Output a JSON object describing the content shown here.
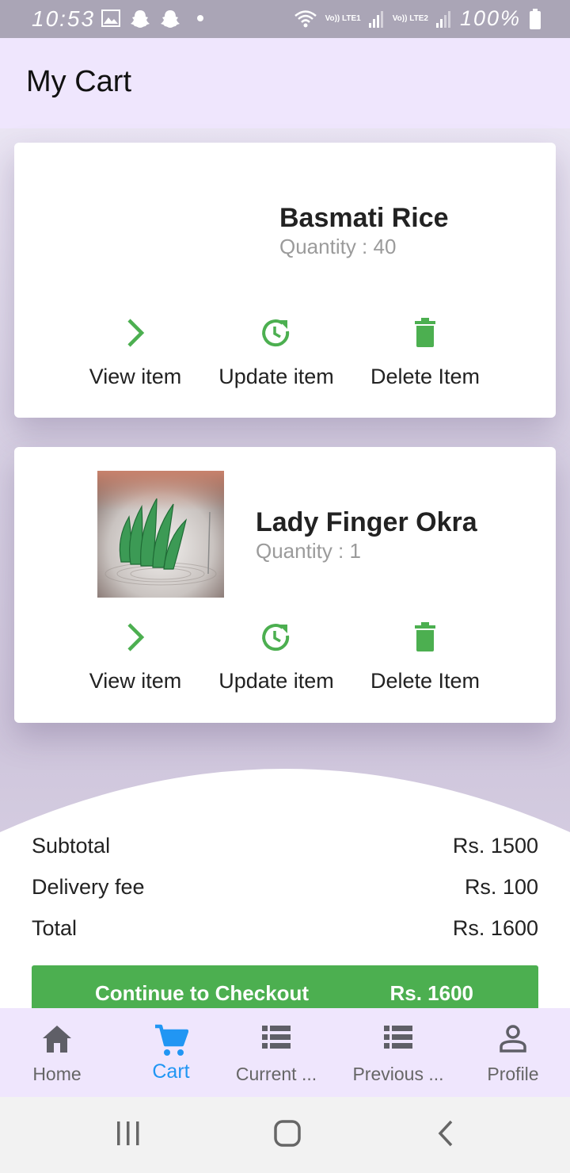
{
  "status_bar": {
    "time": "10:53",
    "battery": "100%",
    "sim1_label": "Vo)) LTE1",
    "sim2_label": "Vo)) LTE2"
  },
  "header": {
    "title": "My Cart"
  },
  "cart_items": [
    {
      "name": "Basmati Rice",
      "quantity": "Quantity : 40",
      "actions": {
        "view": "View item",
        "update": "Update item",
        "delete": "Delete Item"
      }
    },
    {
      "name": "Lady Finger Okra",
      "quantity": "Quantity : 1",
      "actions": {
        "view": "View item",
        "update": "Update item",
        "delete": "Delete Item"
      }
    }
  ],
  "summary": {
    "subtotal_label": "Subtotal",
    "subtotal_value": "Rs. 1500",
    "delivery_label": "Delivery fee",
    "delivery_value": "Rs. 100",
    "total_label": "Total",
    "total_value": "Rs. 1600"
  },
  "checkout": {
    "label": "Continue to Checkout",
    "amount": "Rs. 1600"
  },
  "bottom_nav": [
    {
      "label": "Home",
      "icon": "home-icon"
    },
    {
      "label": "Cart",
      "icon": "cart-icon"
    },
    {
      "label": "Current ...",
      "icon": "list-icon"
    },
    {
      "label": "Previous ...",
      "icon": "list-icon"
    },
    {
      "label": "Profile",
      "icon": "person-icon"
    }
  ],
  "colors": {
    "accent_green": "#4caf50",
    "active_nav_blue": "#2196f3",
    "app_bar_bg": "#efe6fd"
  }
}
